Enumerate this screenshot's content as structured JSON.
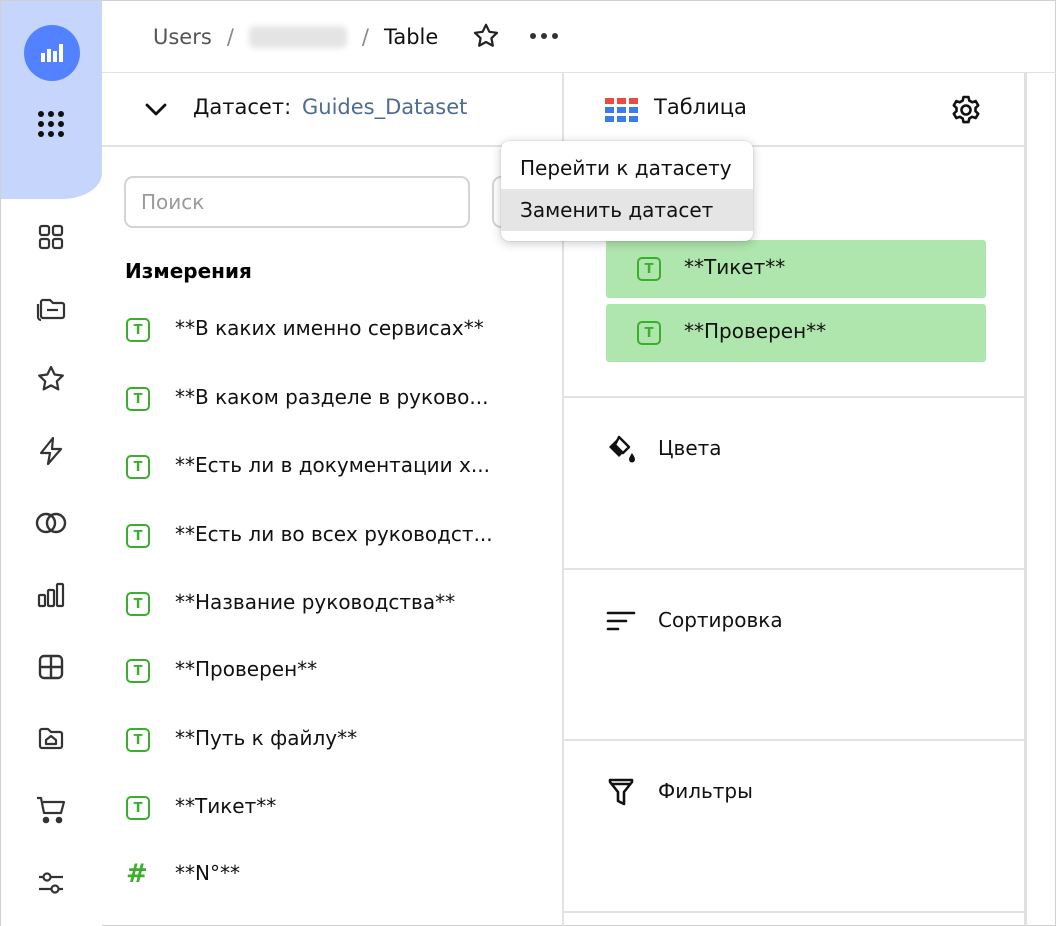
{
  "header": {
    "breadcrumb_root": "Users",
    "breadcrumb_user": "",
    "breadcrumb_current": "Table"
  },
  "dataset": {
    "label": "Датасет:",
    "name": "Guides_Dataset",
    "search_placeholder": "Поиск",
    "section_title": "Измерения",
    "fields": [
      {
        "type": "text",
        "label": "**В каких именно сервисах**"
      },
      {
        "type": "text",
        "label": "**В каком разделе в руково..."
      },
      {
        "type": "text",
        "label": "**Есть ли в документации х..."
      },
      {
        "type": "text",
        "label": "**Есть ли во всех руководст..."
      },
      {
        "type": "text",
        "label": "**Название руководства**"
      },
      {
        "type": "text",
        "label": "**Проверен**"
      },
      {
        "type": "text",
        "label": "**Путь к файлу**"
      },
      {
        "type": "text",
        "label": "**Тикет**"
      },
      {
        "type": "number",
        "label": "**N°**"
      }
    ],
    "text_badge": "T",
    "number_badge": "#"
  },
  "visualization": {
    "label": "Таблица",
    "chips": [
      "**Тикет**",
      "**Проверен**"
    ],
    "sections": [
      {
        "icon": "fill-color-icon",
        "label": "Цвета"
      },
      {
        "icon": "sort-icon",
        "label": "Сортировка"
      },
      {
        "icon": "filter-icon",
        "label": "Фильтры"
      }
    ]
  },
  "menu": {
    "items": [
      "Перейти к датасету",
      "Заменить датасет"
    ]
  },
  "colors": {
    "accent": "#5282ff",
    "rail_highlight": "#c5d5fb",
    "field_green": "#3bae2d",
    "chip_bg": "#afe6ad",
    "dataset_name": "#4f6b93"
  }
}
